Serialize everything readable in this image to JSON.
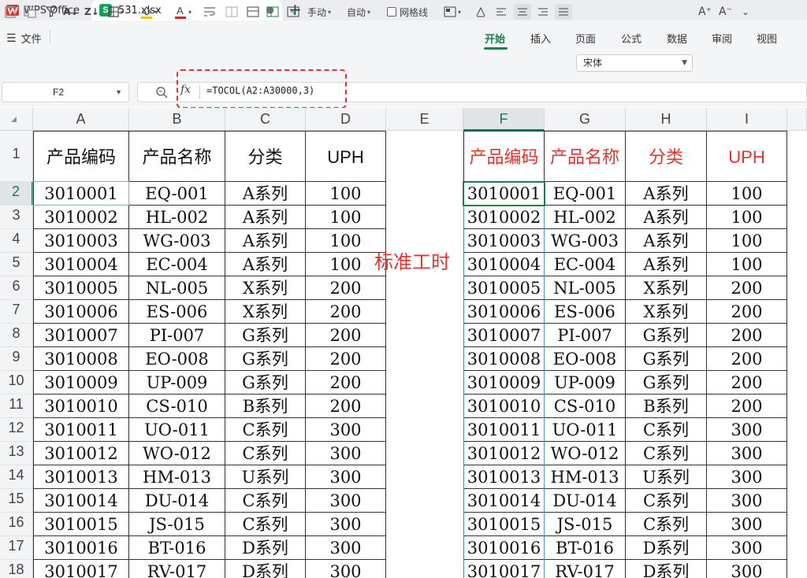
{
  "titlebar": {
    "app_tab": "WPS Office",
    "file_tab": "531.xlsx",
    "file_badge": "S",
    "tab_dot": "●"
  },
  "menu": {
    "file": "文件",
    "items": [
      "开始",
      "插入",
      "页面",
      "公式",
      "数据",
      "审阅",
      "视图"
    ],
    "active": "开始"
  },
  "toolbar": {
    "manual_label": "手动",
    "auto_label": "自动",
    "gridlines_label": "网格线",
    "font_name": "宋体",
    "font_grow": "A⁺",
    "font_shrink": "A⁻"
  },
  "formula_bar": {
    "name_box": "F2",
    "fx": "fx",
    "formula": "=TOCOL(A2:A30000,3)"
  },
  "sheet": {
    "columns": [
      "A",
      "B",
      "C",
      "D",
      "E",
      "F",
      "G",
      "H",
      "I"
    ],
    "selected_column": "F",
    "row_numbers": [
      "1",
      "2",
      "3",
      "4",
      "5",
      "6",
      "7",
      "8",
      "9",
      "10",
      "11",
      "12",
      "13",
      "14",
      "15",
      "16",
      "17",
      "18"
    ],
    "selected_row": "2",
    "headers": [
      "产品编码",
      "产品名称",
      "分类",
      "UPH"
    ],
    "rows": [
      [
        "3010001",
        "EQ-001",
        "A系列",
        "100"
      ],
      [
        "3010002",
        "HL-002",
        "A系列",
        "100"
      ],
      [
        "3010003",
        "WG-003",
        "A系列",
        "100"
      ],
      [
        "3010004",
        "EC-004",
        "A系列",
        "100"
      ],
      [
        "3010005",
        "NL-005",
        "X系列",
        "200"
      ],
      [
        "3010006",
        "ES-006",
        "X系列",
        "200"
      ],
      [
        "3010007",
        "PI-007",
        "G系列",
        "200"
      ],
      [
        "3010008",
        "EO-008",
        "G系列",
        "200"
      ],
      [
        "3010009",
        "UP-009",
        "G系列",
        "200"
      ],
      [
        "3010010",
        "CS-010",
        "B系列",
        "200"
      ],
      [
        "3010011",
        "UO-011",
        "C系列",
        "300"
      ],
      [
        "3010012",
        "WO-012",
        "C系列",
        "300"
      ],
      [
        "3010013",
        "HM-013",
        "U系列",
        "300"
      ],
      [
        "3010014",
        "DU-014",
        "C系列",
        "300"
      ],
      [
        "3010015",
        "JS-015",
        "C系列",
        "300"
      ],
      [
        "3010016",
        "BT-016",
        "D系列",
        "300"
      ],
      [
        "3010017",
        "RV-017",
        "D系列",
        "300"
      ]
    ],
    "annotation": "标准工时",
    "colors": {
      "accent": "#1a7f4b",
      "header_red": "#e8302d",
      "annotation": "#e8302d"
    }
  }
}
